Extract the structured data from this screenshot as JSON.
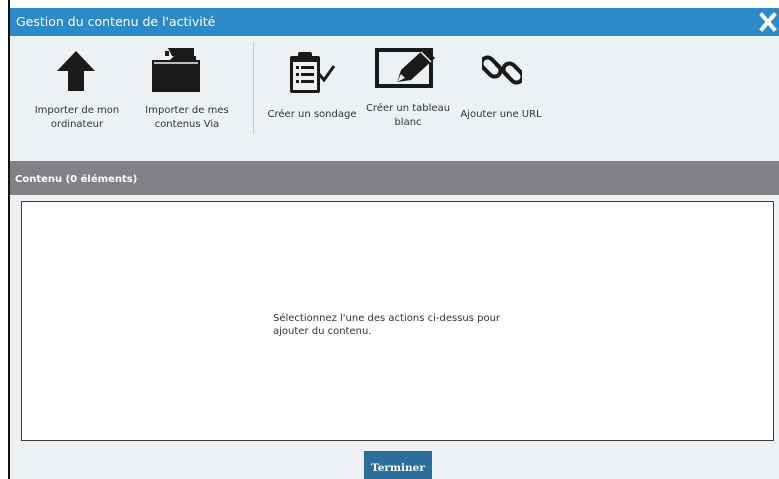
{
  "dialog": {
    "title": "Gestion du contenu de l'activité",
    "close_icon": "close-icon"
  },
  "toolbar": {
    "items": [
      {
        "label": "Importer de mon\nordinateur",
        "icon": "upload-arrow-icon"
      },
      {
        "label": "Importer de mes\ncontenus Via",
        "icon": "folder-icon"
      },
      {
        "label": "Créer un sondage",
        "icon": "clipboard-checklist-icon"
      },
      {
        "label": "Créer un tableau\nblanc",
        "icon": "whiteboard-pencil-icon"
      },
      {
        "label": "Ajouter une URL",
        "icon": "link-chain-icon"
      }
    ]
  },
  "content": {
    "header": "Contenu (0 éléments)",
    "empty_message": "Sélectionnez l'une des actions ci-dessus pour ajouter du contenu."
  },
  "footer": {
    "finish_label": "Terminer"
  },
  "colors": {
    "titlebar": "#2c8ac8",
    "toolbar_bg": "#eef1f3",
    "section_header": "#808285",
    "button": "#2a6f9a"
  }
}
